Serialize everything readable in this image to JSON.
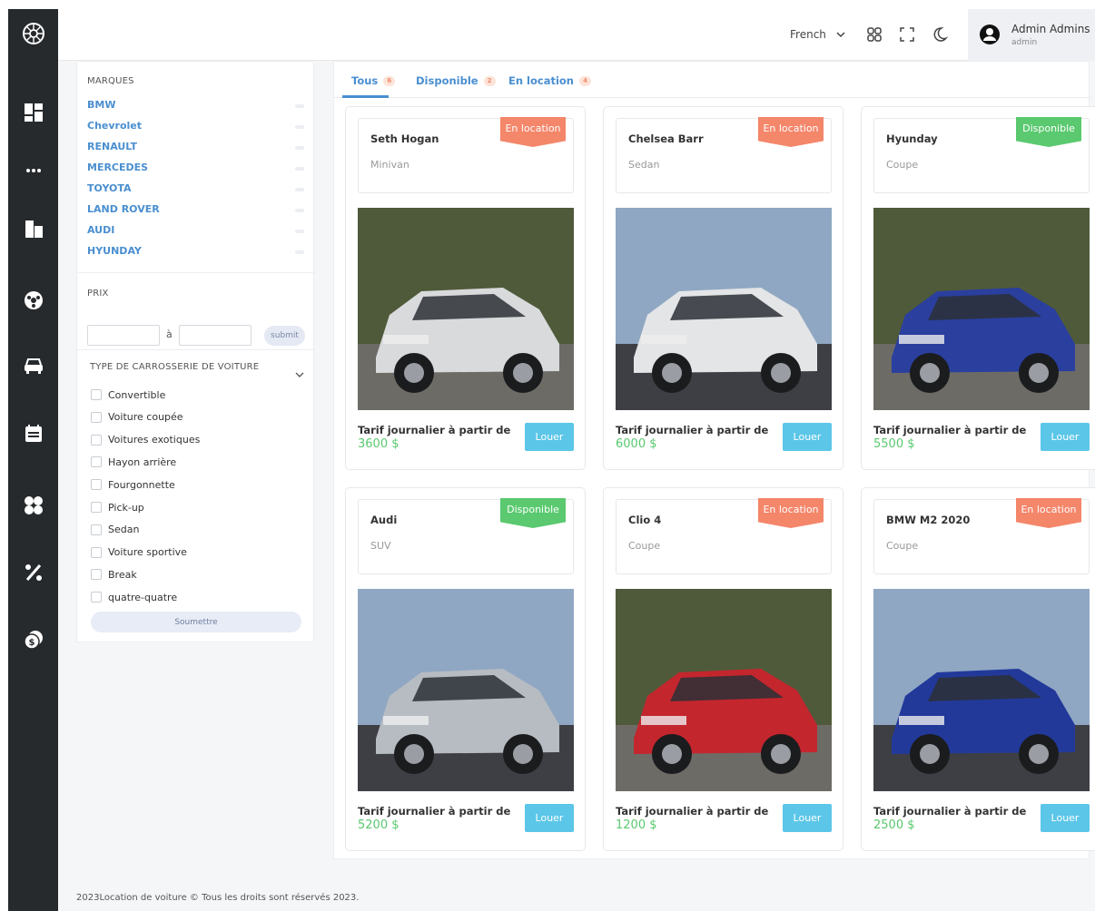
{
  "header": {
    "language": "French",
    "user": {
      "name": "Admin Admins",
      "role": "admin"
    }
  },
  "sidebar": {
    "icons": [
      "logo-icon",
      "dashboard-icon",
      "more-icon",
      "buildings-icon",
      "steering-wheel-icon",
      "car-icon",
      "calendar-icon",
      "apps-icon",
      "percent-icon",
      "coins-icon"
    ]
  },
  "filters": {
    "brands_title": "MARQUES",
    "brands": [
      "BMW",
      "Chevrolet",
      "RENAULT",
      "MERCEDES",
      "TOYOTA",
      "LAND ROVER",
      "AUDI",
      "HYUNDAY"
    ],
    "price_title": "PRIX",
    "price_separator": "à",
    "price_submit": "submit",
    "body_type_title": "TYPE DE CARROSSERIE DE VOITURE",
    "body_types": [
      "Convertible",
      "Voiture coupée",
      "Voitures exotiques",
      "Hayon arrière",
      "Fourgonnette",
      "Pick-up",
      "Sedan",
      "Voiture sportive",
      "Break",
      "quatre-quatre"
    ],
    "submit_label": "Soumettre"
  },
  "tabs": [
    {
      "label": "Tous",
      "count": "6"
    },
    {
      "label": "Disponible",
      "count": "2"
    },
    {
      "label": "En location",
      "count": "4"
    }
  ],
  "cards": [
    {
      "name": "Seth Hogan",
      "type": "Minivan",
      "status": "En location",
      "tarif_label": "Tarif journalier à partir de",
      "price": "3600 $",
      "button": "Louer",
      "body_color": "#d9dadc"
    },
    {
      "name": "Chelsea Barr",
      "type": "Sedan",
      "status": "En location",
      "tarif_label": "Tarif journalier à partir de",
      "price": "6000 $",
      "button": "Louer",
      "body_color": "#e4e5e7"
    },
    {
      "name": "Hyunday",
      "type": "Coupe",
      "status": "Disponible",
      "tarif_label": "Tarif journalier à partir de",
      "price": "5500 $",
      "button": "Louer",
      "body_color": "#2a3f9e"
    },
    {
      "name": "Audi",
      "type": "SUV",
      "status": "Disponible",
      "tarif_label": "Tarif journalier à partir de",
      "price": "5200 $",
      "button": "Louer",
      "body_color": "#b7bcc3"
    },
    {
      "name": "Clio 4",
      "type": "Coupe",
      "status": "En location",
      "tarif_label": "Tarif journalier à partir de",
      "price": "1200 $",
      "button": "Louer",
      "body_color": "#c4262e"
    },
    {
      "name": "BMW M2 2020",
      "type": "Coupe",
      "status": "En location",
      "tarif_label": "Tarif journalier à partir de",
      "price": "2500 $",
      "button": "Louer",
      "body_color": "#22399a"
    }
  ],
  "footer": {
    "text": "2023Location de voiture © Tous les droits sont réservés 2023."
  }
}
